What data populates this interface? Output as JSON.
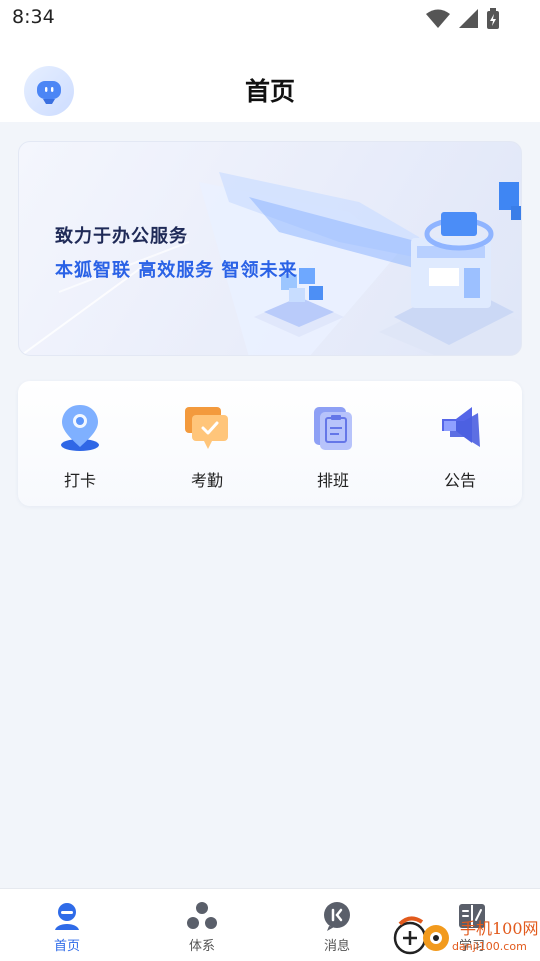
{
  "status_bar": {
    "time": "8:34"
  },
  "header": {
    "title": "首页"
  },
  "banner": {
    "line1": "致力于办公服务",
    "line2": "本狐智联 高效服务 智领未来"
  },
  "shortcuts": [
    {
      "label": "打卡",
      "icon": "location-pin-icon"
    },
    {
      "label": "考勤",
      "icon": "attendance-chat-check-icon"
    },
    {
      "label": "排班",
      "icon": "schedule-clipboard-icon"
    },
    {
      "label": "公告",
      "icon": "megaphone-icon"
    }
  ],
  "tabbar": {
    "items": [
      {
        "label": "首页",
        "icon": "home-avatar-icon",
        "active": true
      },
      {
        "label": "体系",
        "icon": "network-nodes-icon",
        "active": false
      },
      {
        "label": "消息",
        "icon": "message-bubble-icon",
        "active": false
      },
      {
        "label": "学习",
        "icon": "study-book-icon",
        "active": false
      }
    ]
  },
  "watermark": {
    "name": "手机100网",
    "url": "danji100.com"
  },
  "colors": {
    "accent": "#2f6be8",
    "background": "#f2f5fa",
    "banner_title": "#1f2a57",
    "banner_subtitle": "#2a62e6"
  }
}
